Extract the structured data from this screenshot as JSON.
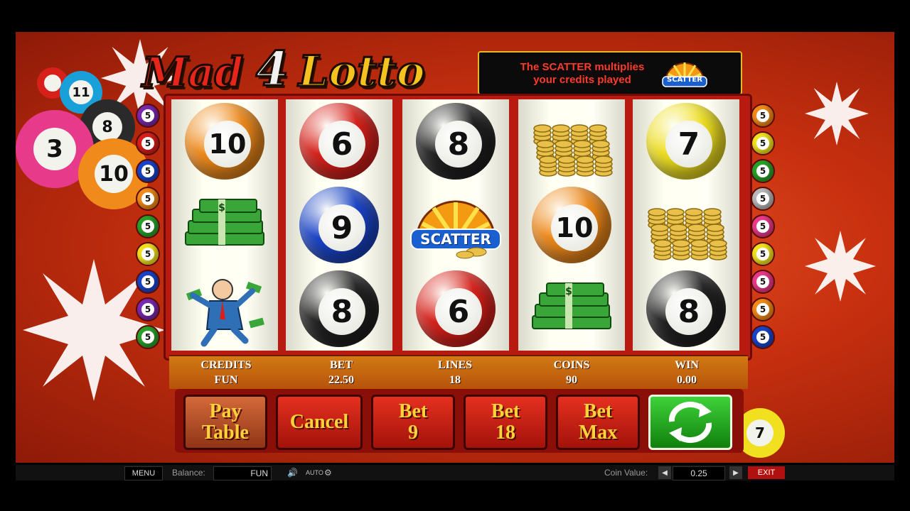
{
  "game": {
    "logo": {
      "word1": "Mad",
      "word2": "4",
      "word3": "Lotto"
    },
    "message": {
      "line1": "The SCATTER multiplies",
      "line2": "your credits played"
    },
    "scatter_label": "SCATTER"
  },
  "line_markers": {
    "left": [
      "5",
      "5",
      "5",
      "5",
      "5",
      "5",
      "5",
      "5",
      "5"
    ],
    "right": [
      "5",
      "5",
      "5",
      "5",
      "5",
      "5",
      "5",
      "5",
      "5"
    ]
  },
  "reels": [
    [
      {
        "type": "ball",
        "number": "10",
        "color": "orange"
      },
      {
        "type": "cash",
        "icon": "cash-stack-icon"
      },
      {
        "type": "man",
        "icon": "money-man-icon"
      }
    ],
    [
      {
        "type": "ball",
        "number": "6",
        "color": "red"
      },
      {
        "type": "ball",
        "number": "9",
        "color": "blue"
      },
      {
        "type": "ball",
        "number": "8",
        "color": "black"
      }
    ],
    [
      {
        "type": "ball",
        "number": "8",
        "color": "black"
      },
      {
        "type": "scatter",
        "label": "SCATTER"
      },
      {
        "type": "ball",
        "number": "6",
        "color": "red"
      }
    ],
    [
      {
        "type": "coins",
        "icon": "coin-stack-icon"
      },
      {
        "type": "ball",
        "number": "10",
        "color": "orange"
      },
      {
        "type": "cash",
        "icon": "cash-stack-icon"
      }
    ],
    [
      {
        "type": "ball",
        "number": "7",
        "color": "yellow"
      },
      {
        "type": "coins",
        "icon": "coin-stack-icon"
      },
      {
        "type": "ball",
        "number": "8",
        "color": "black"
      }
    ]
  ],
  "stats": {
    "credits": {
      "label": "CREDITS",
      "value": "FUN"
    },
    "bet": {
      "label": "BET",
      "value": "22.50"
    },
    "lines": {
      "label": "LINES",
      "value": "18"
    },
    "coins": {
      "label": "COINS",
      "value": "90"
    },
    "win": {
      "label": "WIN",
      "value": "0.00"
    }
  },
  "buttons": {
    "paytable": {
      "line1": "Pay",
      "line2": "Table"
    },
    "cancel": "Cancel",
    "bet9": {
      "line1": "Bet",
      "line2": "9"
    },
    "bet18": {
      "line1": "Bet",
      "line2": "18"
    },
    "betmax": {
      "line1": "Bet",
      "line2": "Max"
    }
  },
  "bottom_bar": {
    "menu": "MENU",
    "balance_label": "Balance:",
    "balance_value": "FUN",
    "auto": "AUTO",
    "coin_value_label": "Coin Value:",
    "coin_value": "0.25",
    "exit": "EXIT"
  },
  "background_balls": [
    "11",
    "8",
    "3",
    "10",
    "7"
  ],
  "colors": {
    "orange": "#f08a1a",
    "red": "#d8201a",
    "blue": "#1a44c8",
    "black": "#202020",
    "yellow": "#f0e020",
    "green": "#2aa02a",
    "purple": "#7a2ab0",
    "pink": "#e83a8a",
    "gray": "#b8b8b8"
  }
}
